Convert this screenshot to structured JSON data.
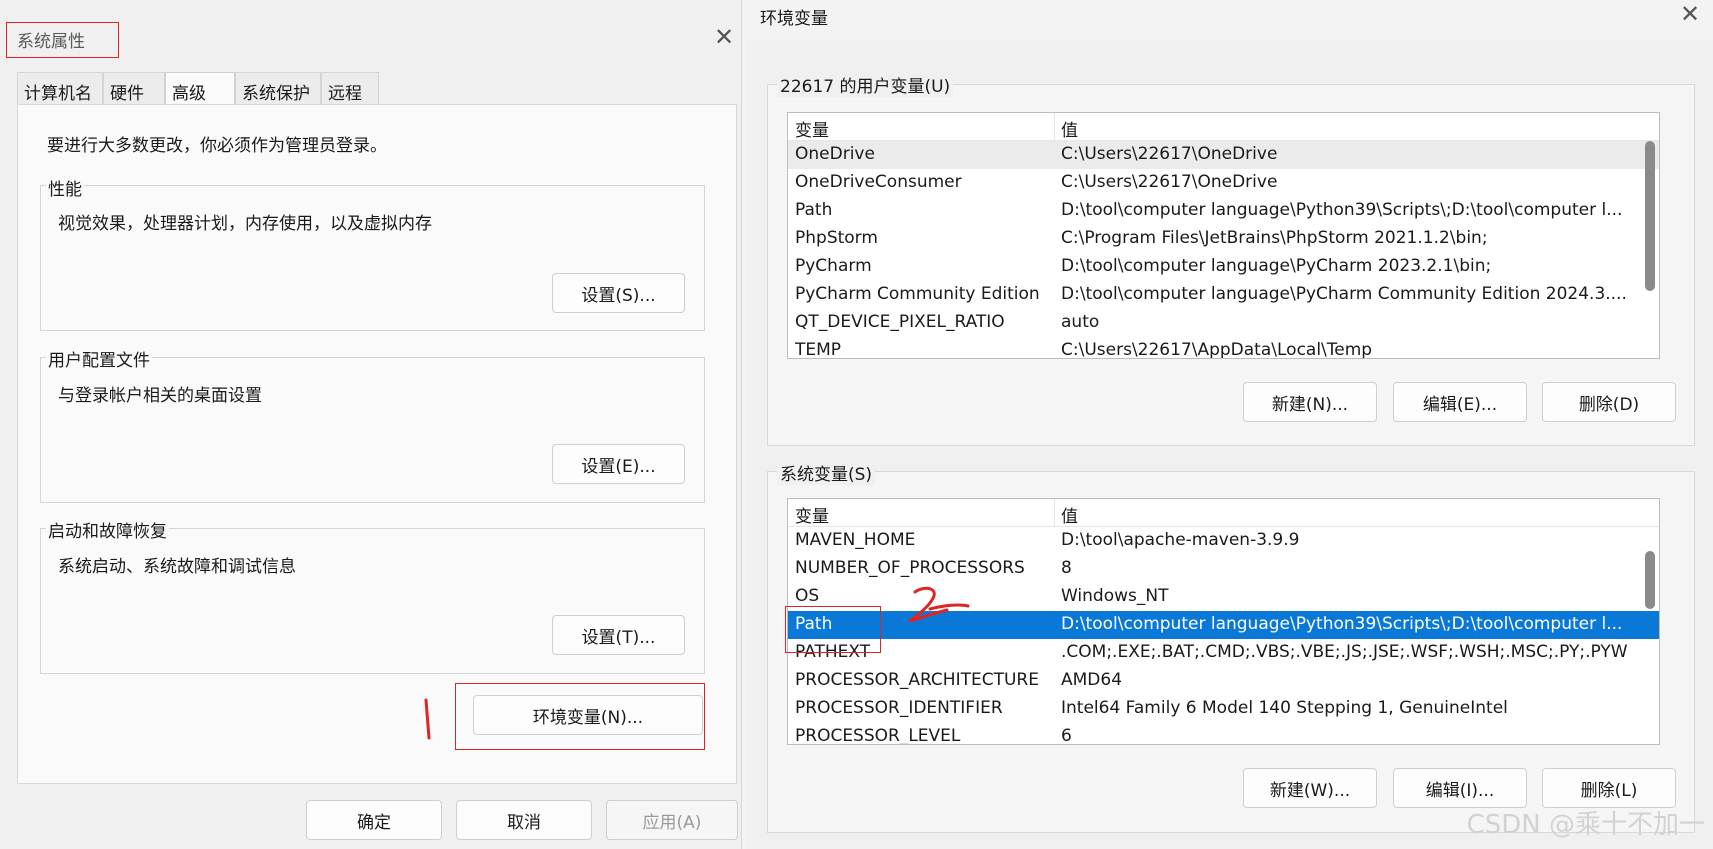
{
  "system_properties": {
    "title": "系统属性",
    "tabs": [
      {
        "label": "计算机名",
        "active": false
      },
      {
        "label": "硬件",
        "active": false
      },
      {
        "label": "高级",
        "active": true
      },
      {
        "label": "系统保护",
        "active": false
      },
      {
        "label": "远程",
        "active": false
      }
    ],
    "admin_note": "要进行大多数更改，你必须作为管理员登录。",
    "groups": [
      {
        "label": "性能",
        "description": "视觉效果，处理器计划，内存使用，以及虚拟内存",
        "button": "设置(S)..."
      },
      {
        "label": "用户配置文件",
        "description": "与登录帐户相关的桌面设置",
        "button": "设置(E)..."
      },
      {
        "label": "启动和故障恢复",
        "description": "系统启动、系统故障和调试信息",
        "button": "设置(T)..."
      }
    ],
    "env_button": "环境变量(N)...",
    "footer_buttons": {
      "ok": "确定",
      "cancel": "取消",
      "apply": "应用(A)"
    }
  },
  "environment_variables": {
    "title": "环境变量",
    "user_section": {
      "label": "22617 的用户变量(U)",
      "columns": [
        "变量",
        "值"
      ],
      "rows": [
        {
          "name": "OneDrive",
          "value": "C:\\Users\\22617\\OneDrive"
        },
        {
          "name": "OneDriveConsumer",
          "value": "C:\\Users\\22617\\OneDrive"
        },
        {
          "name": "Path",
          "value": "D:\\tool\\computer language\\Python39\\Scripts\\;D:\\tool\\computer l..."
        },
        {
          "name": "PhpStorm",
          "value": "C:\\Program Files\\JetBrains\\PhpStorm 2021.1.2\\bin;"
        },
        {
          "name": "PyCharm",
          "value": "D:\\tool\\computer language\\PyCharm 2023.2.1\\bin;"
        },
        {
          "name": "PyCharm Community Edition",
          "value": "D:\\tool\\computer language\\PyCharm Community Edition 2024.3...."
        },
        {
          "name": "QT_DEVICE_PIXEL_RATIO",
          "value": "auto"
        },
        {
          "name": "TEMP",
          "value": "C:\\Users\\22617\\AppData\\Local\\Temp"
        }
      ],
      "buttons": {
        "new": "新建(N)...",
        "edit": "编辑(E)...",
        "delete": "删除(D)"
      }
    },
    "system_section": {
      "label": "系统变量(S)",
      "columns": [
        "变量",
        "值"
      ],
      "rows": [
        {
          "name": "MAVEN_HOME",
          "value": "D:\\tool\\apache-maven-3.9.9"
        },
        {
          "name": "NUMBER_OF_PROCESSORS",
          "value": "8"
        },
        {
          "name": "OS",
          "value": "Windows_NT"
        },
        {
          "name": "Path",
          "value": "D:\\tool\\computer language\\Python39\\Scripts\\;D:\\tool\\computer l...",
          "selected": true
        },
        {
          "name": "PATHEXT",
          "value": ".COM;.EXE;.BAT;.CMD;.VBS;.VBE;.JS;.JSE;.WSF;.WSH;.MSC;.PY;.PYW"
        },
        {
          "name": "PROCESSOR_ARCHITECTURE",
          "value": "AMD64"
        },
        {
          "name": "PROCESSOR_IDENTIFIER",
          "value": "Intel64 Family 6 Model 140 Stepping 1, GenuineIntel"
        },
        {
          "name": "PROCESSOR_LEVEL",
          "value": "6"
        }
      ],
      "buttons": {
        "new": "新建(W)...",
        "edit": "编辑(I)...",
        "delete": "删除(L)"
      }
    }
  },
  "annotations": {
    "step1": "1",
    "step2": "2"
  },
  "watermark": "CSDN @乘十不加一",
  "colors": {
    "selection": "#0a78d7",
    "highlight_box": "#e02424"
  }
}
